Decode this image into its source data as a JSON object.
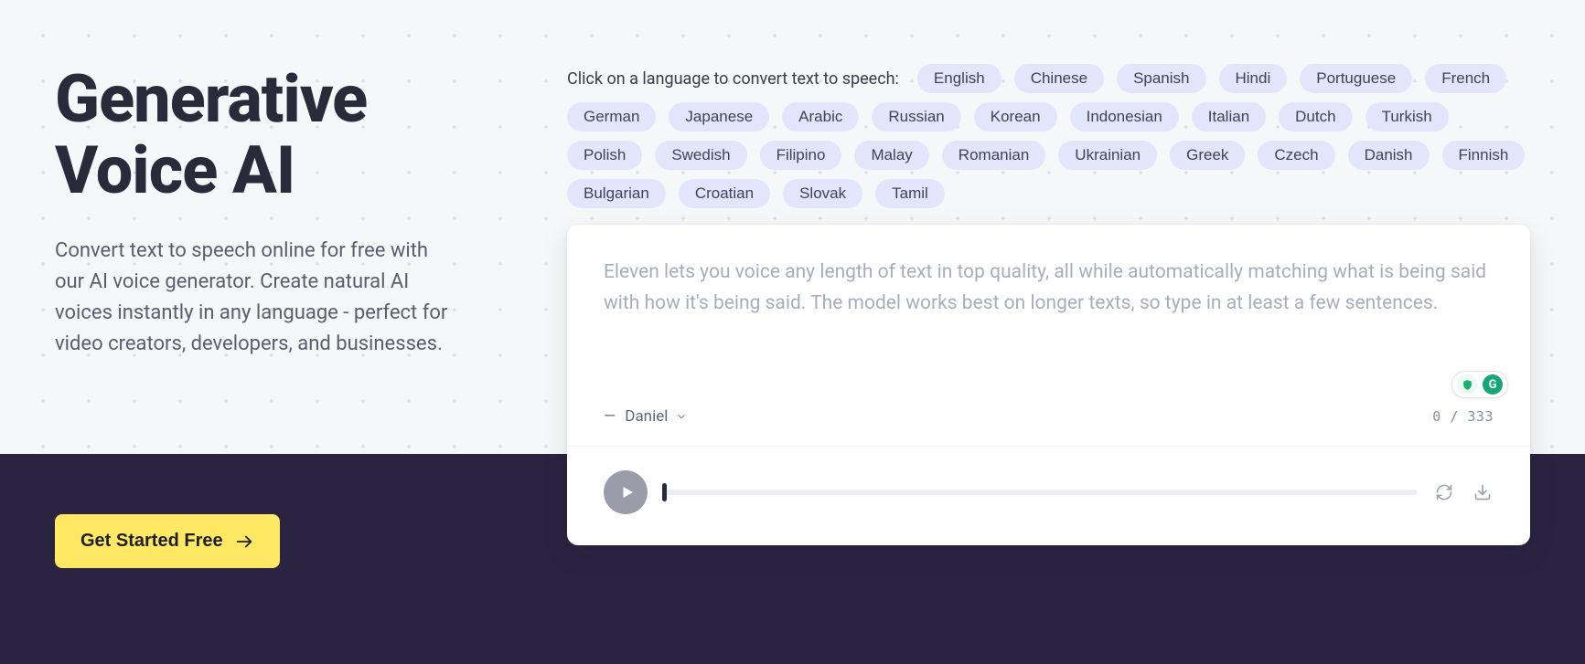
{
  "hero": {
    "title_line1": "Generative",
    "title_line2": "Voice AI",
    "subtitle": "Convert text to speech online for free with our AI voice generator. Create natural AI voices instantly in any language - perfect for video creators, developers, and businesses.",
    "cta_label": "Get Started Free"
  },
  "lang_section": {
    "prompt": "Click on a language to convert text to speech:",
    "items": [
      "English",
      "Chinese",
      "Spanish",
      "Hindi",
      "Portuguese",
      "French",
      "German",
      "Japanese",
      "Arabic",
      "Russian",
      "Korean",
      "Indonesian",
      "Italian",
      "Dutch",
      "Turkish",
      "Polish",
      "Swedish",
      "Filipino",
      "Malay",
      "Romanian",
      "Ukrainian",
      "Greek",
      "Czech",
      "Danish",
      "Finnish",
      "Bulgarian",
      "Croatian",
      "Slovak",
      "Tamil"
    ]
  },
  "editor": {
    "placeholder": "Eleven lets you voice any length of text in top quality, all while automatically matching what is being said with how it's being said. The model works best on longer texts, so type in at least a few sentences.",
    "voice_name": "Daniel",
    "char_count": "0",
    "char_limit": "333"
  }
}
